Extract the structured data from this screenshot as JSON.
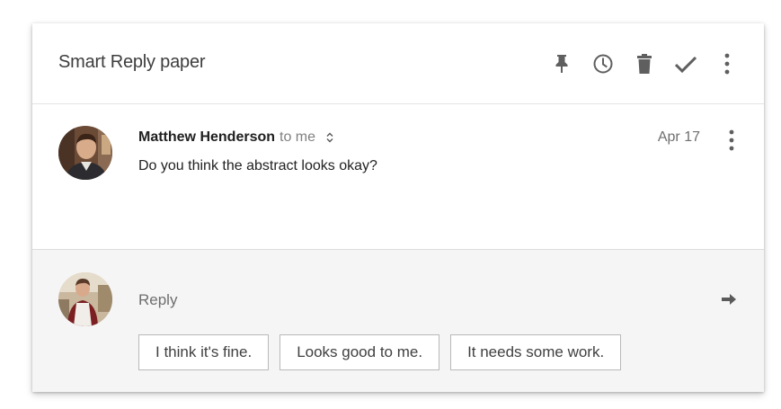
{
  "thread": {
    "subject": "Smart Reply paper"
  },
  "toolbar": {
    "pin_icon": "pin-icon",
    "snooze_icon": "clock-icon",
    "delete_icon": "trash-icon",
    "done_icon": "check-icon",
    "more_icon": "more-vert-icon"
  },
  "message": {
    "sender": "Matthew Henderson",
    "recipient": "to me",
    "date": "Apr 17",
    "body": "Do you think the abstract looks okay?"
  },
  "reply": {
    "placeholder": "Reply",
    "send_icon": "arrow-right-icon",
    "suggestions": [
      "I think it's fine.",
      "Looks good to me.",
      "It needs some work."
    ]
  },
  "colors": {
    "header_text": "#3d3d3d",
    "icon": "#5f5f5f",
    "reply_bg": "#f5f5f5",
    "chip_border": "#b9b9b9"
  }
}
